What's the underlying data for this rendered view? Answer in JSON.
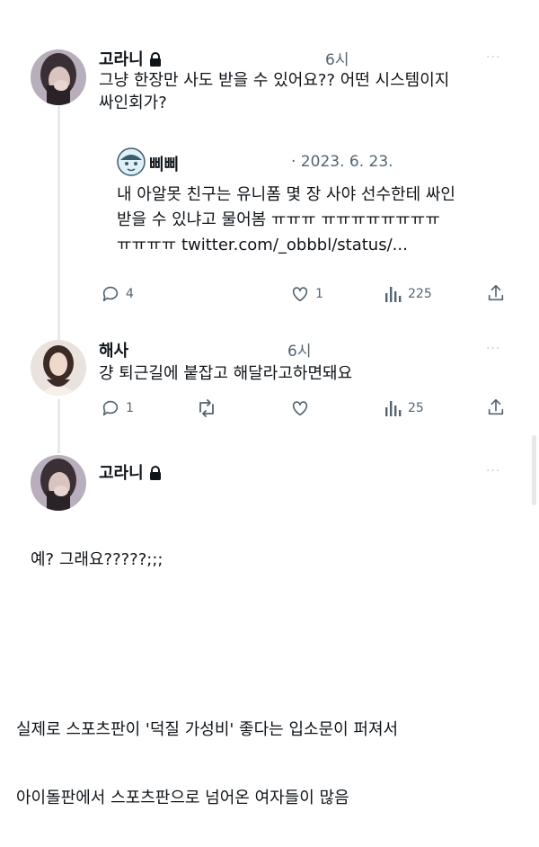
{
  "post1": {
    "name": "고라니",
    "time": "6시",
    "more": "···",
    "text_line1": "그냥 한장만 사도 받을 수 있어요?? 어떤 시스템이지",
    "text_line2": "싸인회가?",
    "quote": {
      "name": "삐삐",
      "date": "· 2023. 6. 23.",
      "line1": "내 아알못 친구는 유니폼 몇 장 사야 선수한테 싸인",
      "line2": "받을 수 있냐고 물어봄 ㅠㅠㅠ  ㅠㅠㅠㅠㅠㅠㅠㅠ",
      "line3": "ㅠㅠㅠㅠ twitter.com/_obbbl/status/..."
    },
    "actions": {
      "reply": "4",
      "like": "1",
      "views": "225"
    }
  },
  "post2": {
    "name": "해사",
    "time": "6시",
    "more": "···",
    "text": "걍 퇴근길에 붙잡고 해달라고하면돼요",
    "actions": {
      "reply": "1",
      "retweet": "",
      "like": "",
      "views": "25"
    }
  },
  "post3": {
    "name": "고라니",
    "more": "···"
  },
  "captions": {
    "c1": "예? 그래요?????;;;",
    "c2": "실제로 스포츠판이 '덕질 가성비' 좋다는 입소문이 퍼져서",
    "c3": "아이돌판에서 스포츠판으로 넘어온 여자들이 많음"
  },
  "icons": {
    "lock": "lock-icon",
    "reply": "reply-icon",
    "retweet": "retweet-icon",
    "like": "heart-icon",
    "views": "views-icon",
    "share": "share-icon",
    "quote_avatar": "quote-avatar-icon"
  },
  "colors": {
    "text": "#0f1419",
    "secondary": "#536471",
    "thread": "#e6e9ec"
  }
}
